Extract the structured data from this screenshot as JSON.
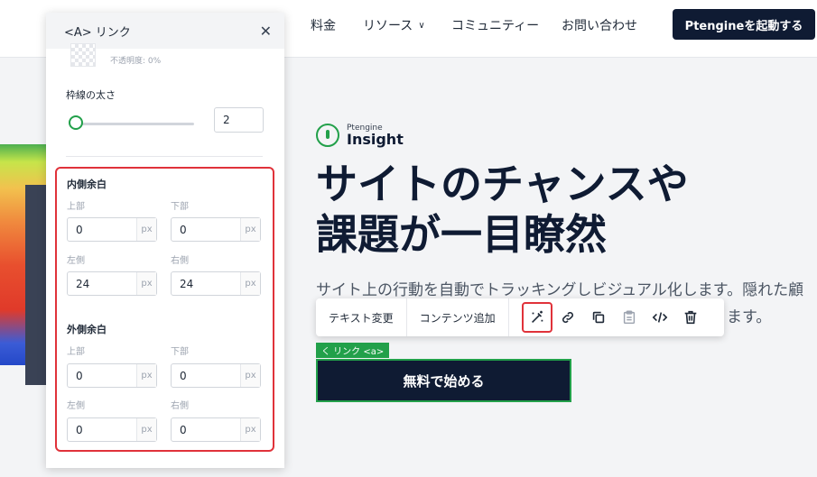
{
  "nav": {
    "items": [
      {
        "label": "料金"
      },
      {
        "label": "リソース"
      },
      {
        "label": "コミュニティー"
      },
      {
        "label": "お問い合わせ"
      }
    ],
    "cta": "Ptengineを起動する"
  },
  "hero": {
    "logo_small": "Ptengine",
    "logo_big": "Insight",
    "title_line1": "サイトのチャンスや",
    "title_line2": "課題が一目瞭然",
    "desc_line1": "サイト上の行動を自動でトラッキングしビジュアル化します。隠れた顧",
    "desc_line2": "ます。",
    "cta": "無料で始める"
  },
  "toolbar": {
    "text_change": "テキスト変更",
    "add_content": "コンテンツ追加",
    "icons": [
      "magic-wand-icon",
      "link-icon",
      "copy-icon",
      "clipboard-icon",
      "code-icon",
      "trash-icon"
    ]
  },
  "selection_tag": "く リンク <a>",
  "panel": {
    "title": "<A> リンク",
    "opacity_label": "不透明度: 0%",
    "border_width_label": "枠線の太さ",
    "border_width_value": "2",
    "border_width_slider": 2,
    "inner_padding": {
      "title": "内側余白",
      "top_label": "上部",
      "top_value": "0",
      "bottom_label": "下部",
      "bottom_value": "0",
      "left_label": "左側",
      "left_value": "24",
      "right_label": "右側",
      "right_value": "24"
    },
    "outer_margin": {
      "title": "外側余白",
      "top_label": "上部",
      "top_value": "0",
      "bottom_label": "下部",
      "bottom_value": "0",
      "left_label": "左側",
      "left_value": "0",
      "right_label": "右側",
      "right_value": "0"
    },
    "unit": "px"
  },
  "colors": {
    "brand_dark": "#0f1b33",
    "accent_green": "#22a04a",
    "highlight_red": "#e0323a"
  }
}
